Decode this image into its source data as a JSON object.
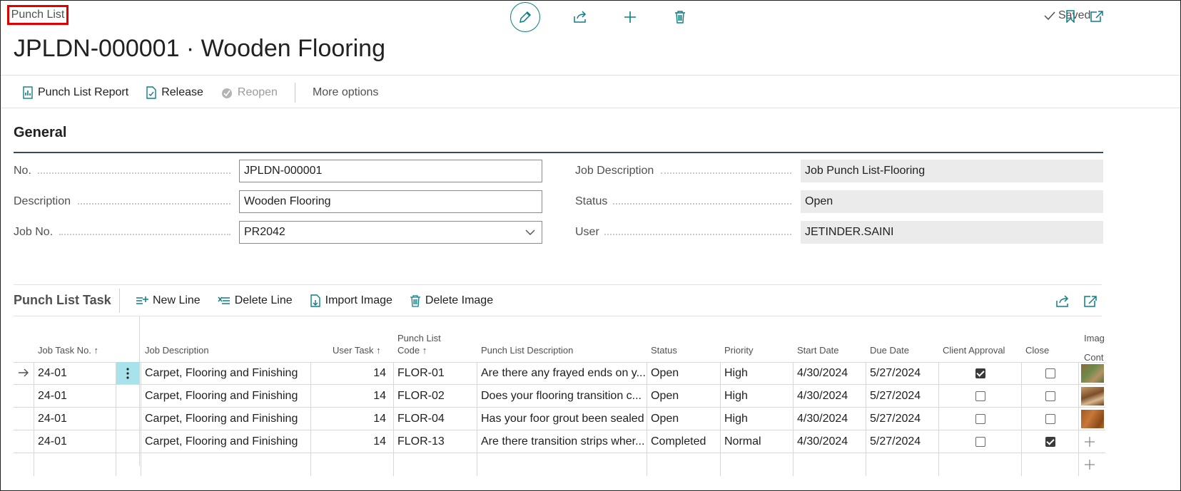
{
  "breadcrumb": "Punch List",
  "title": "JPLDN-000001 · Wooden Flooring",
  "status_saved": "Saved",
  "actions": {
    "report": "Punch List Report",
    "release": "Release",
    "reopen": "Reopen",
    "more": "More options"
  },
  "general": {
    "title": "General",
    "no_label": "No.",
    "no_value": "JPLDN-000001",
    "description_label": "Description",
    "description_value": "Wooden Flooring",
    "job_no_label": "Job No.",
    "job_no_value": "PR2042",
    "job_description_label": "Job Description",
    "job_description_value": "Job Punch List-Flooring",
    "status_label": "Status",
    "status_value": "Open",
    "user_label": "User",
    "user_value": "JETINDER.SAINI"
  },
  "tasks": {
    "title": "Punch List Task",
    "new_line": "New Line",
    "delete_line": "Delete Line",
    "import_image": "Import Image",
    "delete_image": "Delete Image",
    "columns": {
      "job_task_no": "Job Task No. ↑",
      "job_description": "Job Description",
      "user_task": "User Task ↑",
      "punch_list_code_1": "Punch List",
      "punch_list_code_2": "Code ↑",
      "punch_list_description": "Punch List Description",
      "status": "Status",
      "priority": "Priority",
      "start_date": "Start Date",
      "due_date": "Due Date",
      "client_approval": "Client Approval",
      "close": "Close",
      "image_1": "Imag",
      "image_2": "Cont"
    },
    "rows": [
      {
        "job_task_no": "24-01",
        "job_description": "Carpet, Flooring and Finishing",
        "user_task": "14",
        "code": "FLOR-01",
        "description": "Are there any frayed ends on y...",
        "status": "Open",
        "priority": "High",
        "start_date": "4/30/2024",
        "due_date": "5/27/2024",
        "client_approval": true,
        "close": false
      },
      {
        "job_task_no": "24-01",
        "job_description": "Carpet, Flooring and Finishing",
        "user_task": "14",
        "code": "FLOR-02",
        "description": "Does your flooring transition c...",
        "status": "Open",
        "priority": "High",
        "start_date": "4/30/2024",
        "due_date": "5/27/2024",
        "client_approval": false,
        "close": false
      },
      {
        "job_task_no": "24-01",
        "job_description": "Carpet, Flooring and Finishing",
        "user_task": "14",
        "code": "FLOR-04",
        "description": "Has your foor grout been sealed",
        "status": "Open",
        "priority": "High",
        "start_date": "4/30/2024",
        "due_date": "5/27/2024",
        "client_approval": false,
        "close": false
      },
      {
        "job_task_no": "24-01",
        "job_description": "Carpet, Flooring and Finishing",
        "user_task": "14",
        "code": "FLOR-13",
        "description": "Are there transition strips wher...",
        "status": "Completed",
        "priority": "Normal",
        "start_date": "4/30/2024",
        "due_date": "5/27/2024",
        "client_approval": false,
        "close": true
      }
    ]
  },
  "colors": {
    "accent": "#0a7f86",
    "highlight": "#e00000",
    "selected_cell": "#a8e2ea"
  }
}
